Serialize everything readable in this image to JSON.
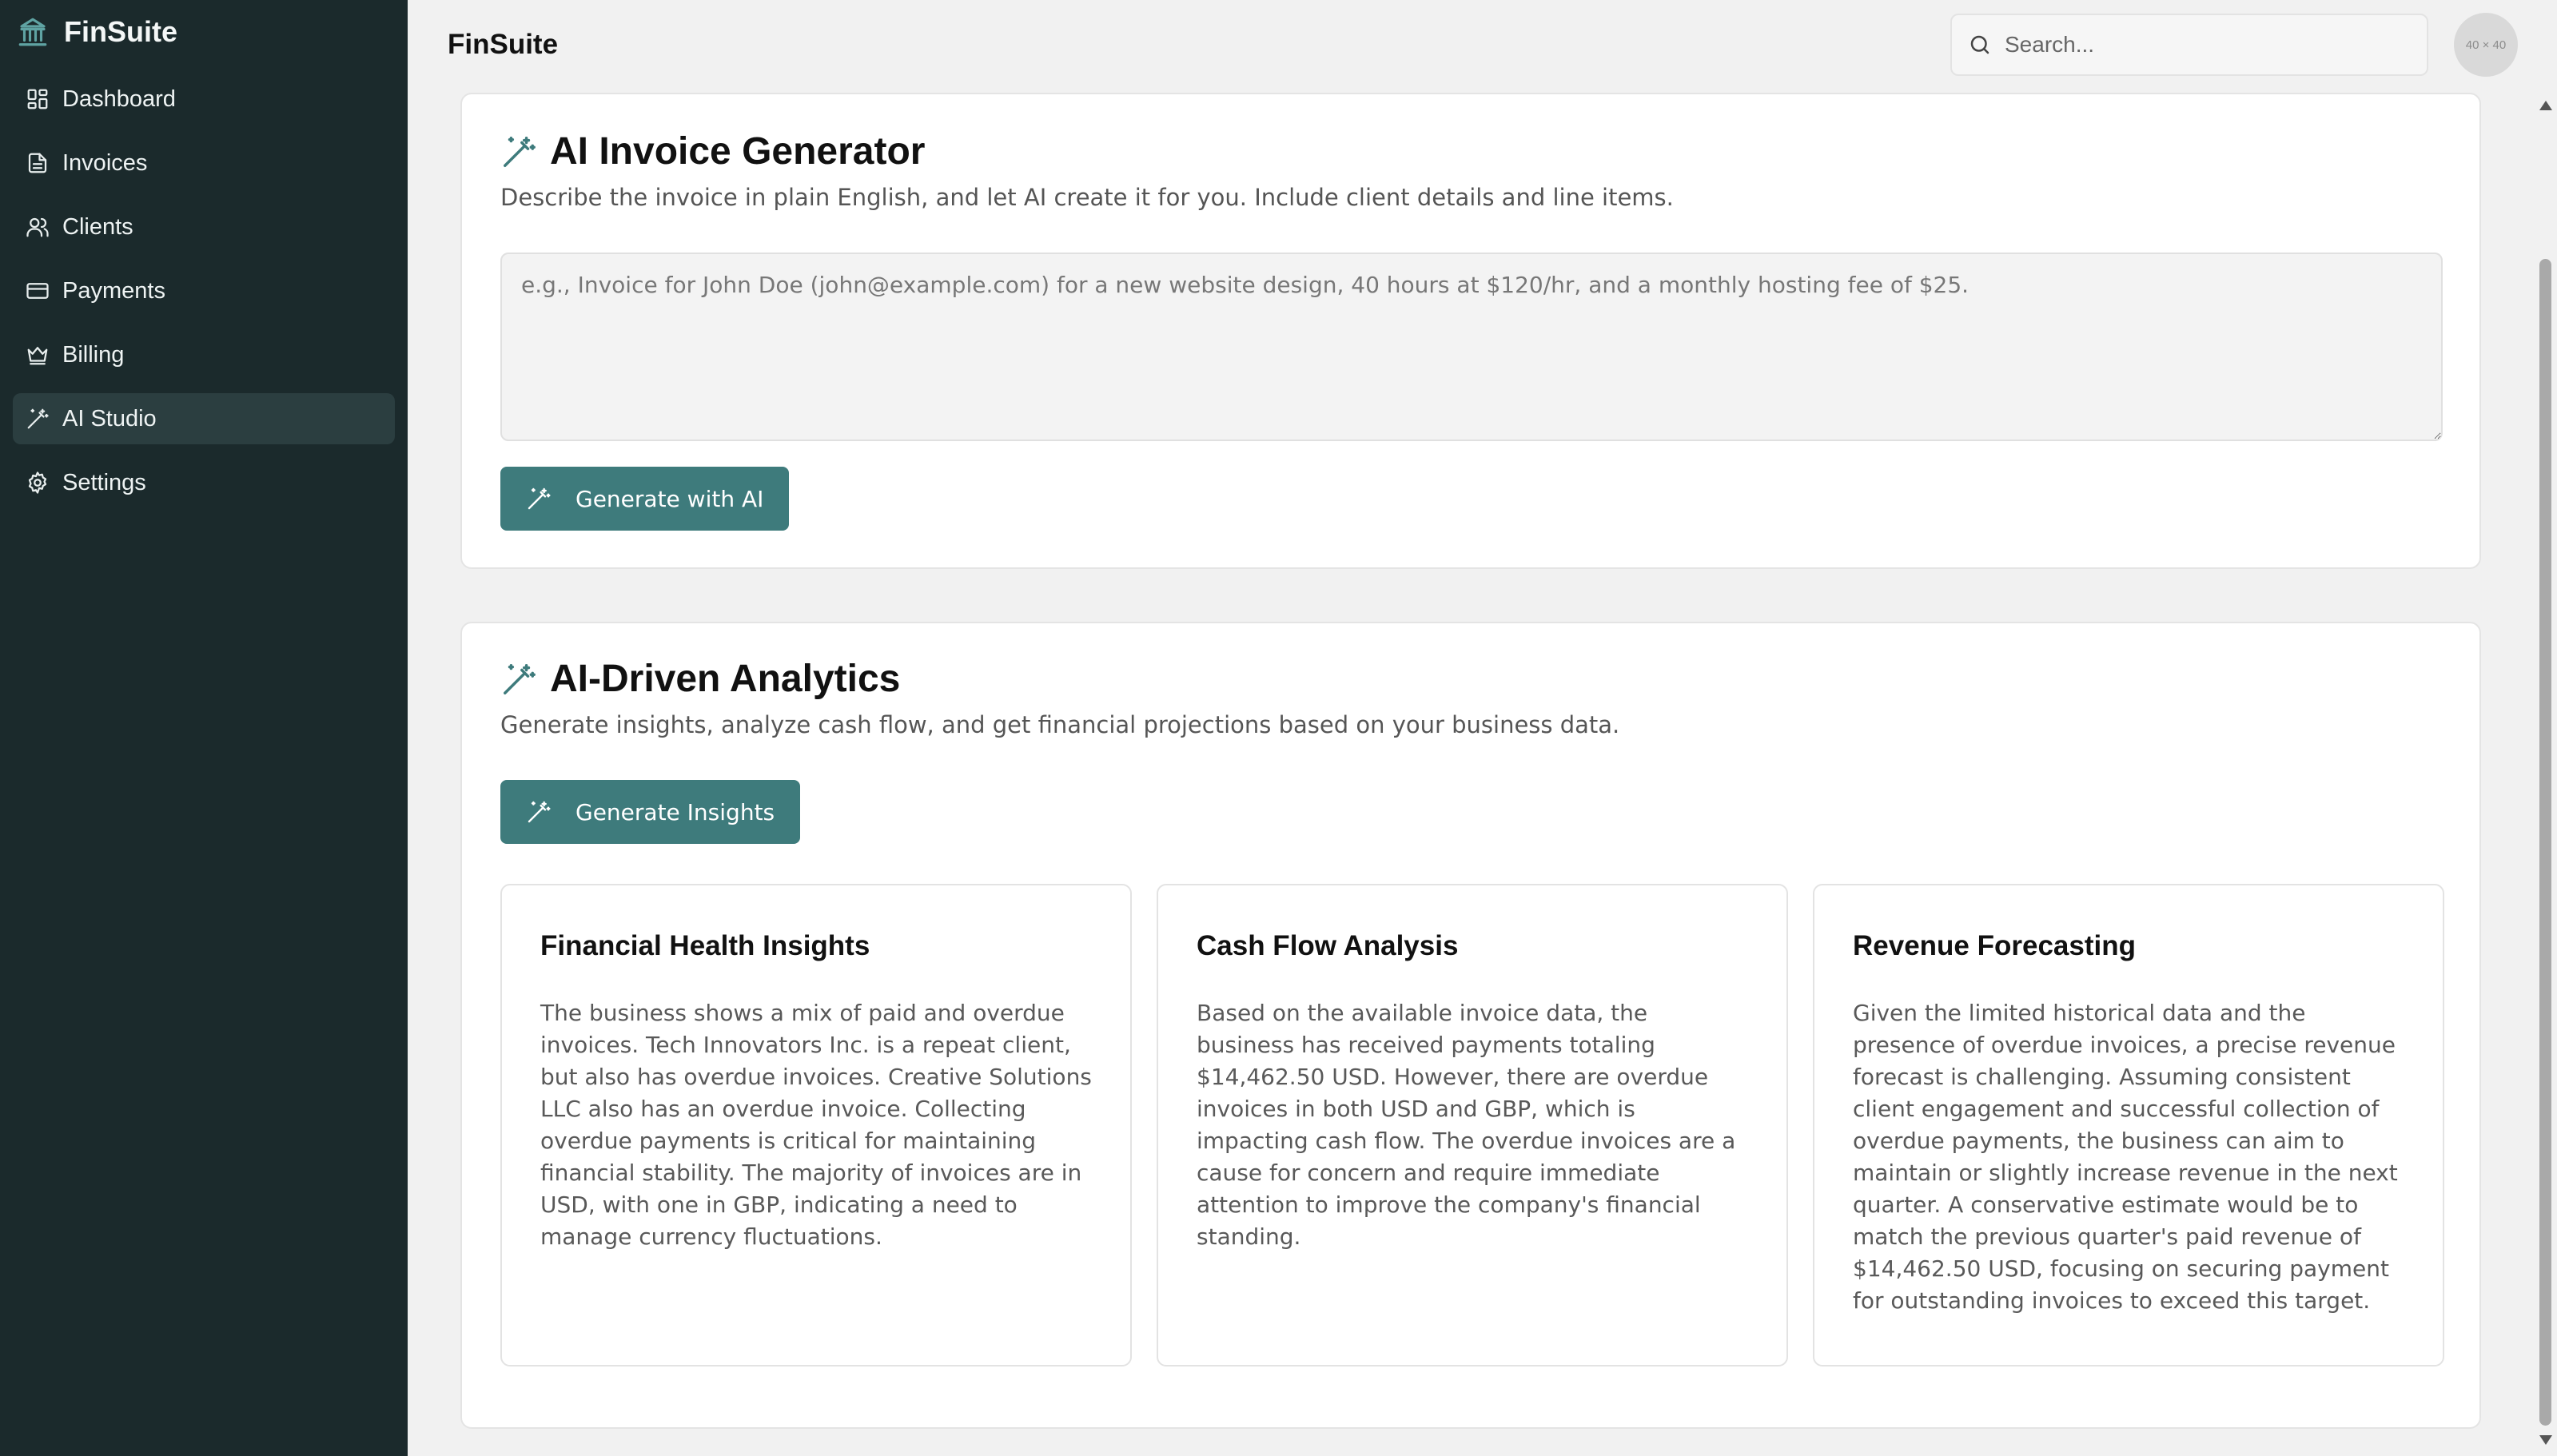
{
  "app": {
    "brand": "FinSuite",
    "accent_color": "#3e7b7c",
    "sidebar_bg": "#1b2a2c"
  },
  "sidebar": {
    "items": [
      {
        "label": "Dashboard",
        "icon": "dashboard-grid-icon"
      },
      {
        "label": "Invoices",
        "icon": "document-icon"
      },
      {
        "label": "Clients",
        "icon": "users-icon"
      },
      {
        "label": "Payments",
        "icon": "credit-card-icon"
      },
      {
        "label": "Billing",
        "icon": "crown-icon"
      },
      {
        "label": "AI Studio",
        "icon": "magic-wand-icon",
        "active": true
      },
      {
        "label": "Settings",
        "icon": "gear-icon"
      }
    ]
  },
  "header": {
    "title": "FinSuite",
    "search_placeholder": "Search...",
    "avatar_text": "40 × 40"
  },
  "invoice_generator": {
    "title": "AI Invoice Generator",
    "description": "Describe the invoice in plain English, and let AI create it for you. Include client details and line items.",
    "prompt_placeholder": "e.g., Invoice for John Doe (john@example.com) for a new website design, 40 hours at $120/hr, and a monthly hosting fee of $25.",
    "prompt_value": "",
    "button_label": "Generate with AI"
  },
  "analytics": {
    "title": "AI-Driven Analytics",
    "description": "Generate insights, analyze cash flow, and get financial projections based on your business data.",
    "button_label": "Generate Insights",
    "insights": [
      {
        "title": "Financial Health Insights",
        "body": "The business shows a mix of paid and overdue invoices. Tech Innovators Inc. is a repeat client, but also has overdue invoices. Creative Solutions LLC also has an overdue invoice. Collecting overdue payments is critical for maintaining financial stability. The majority of invoices are in USD, with one in GBP, indicating a need to manage currency fluctuations."
      },
      {
        "title": "Cash Flow Analysis",
        "body": "Based on the available invoice data, the business has received payments totaling $14,462.50 USD. However, there are overdue invoices in both USD and GBP, which is impacting cash flow. The overdue invoices are a cause for concern and require immediate attention to improve the company's financial standing."
      },
      {
        "title": "Revenue Forecasting",
        "body": "Given the limited historical data and the presence of overdue invoices, a precise revenue forecast is challenging. Assuming consistent client engagement and successful collection of overdue payments, the business can aim to maintain or slightly increase revenue in the next quarter. A conservative estimate would be to match the previous quarter's paid revenue of $14,462.50 USD, focusing on securing payment for outstanding invoices to exceed this target."
      }
    ]
  }
}
